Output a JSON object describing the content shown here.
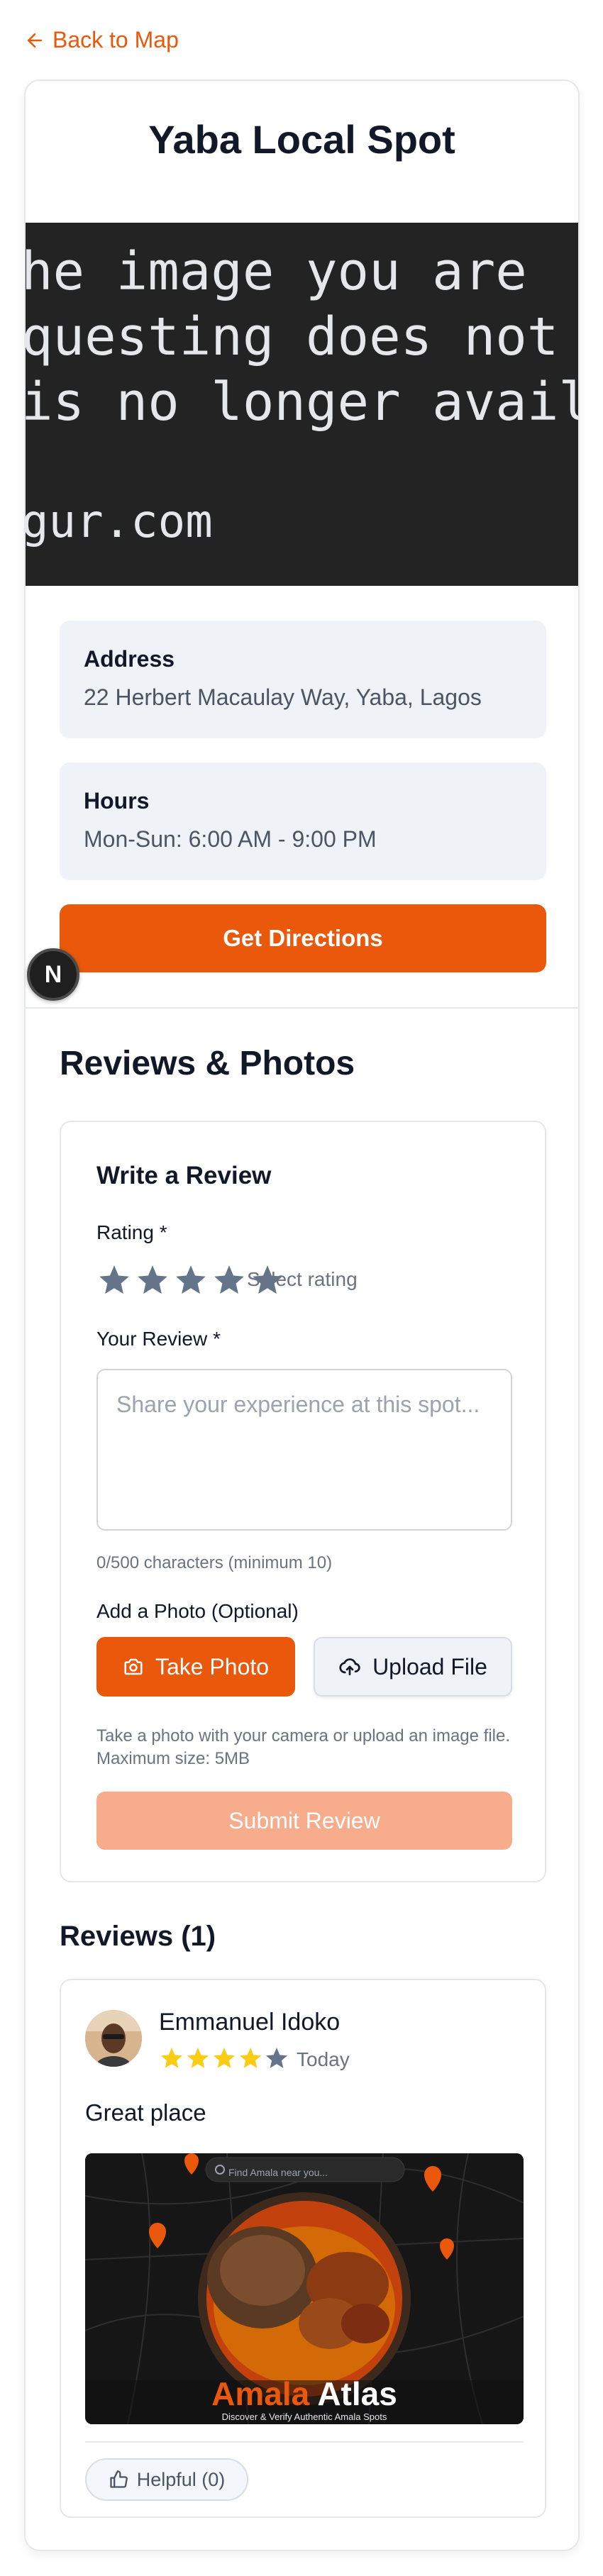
{
  "nav": {
    "back_label": "Back to Map"
  },
  "spot": {
    "title": "Yaba Local Spot",
    "image_text": [
      "he image you are",
      "questing does not exi",
      "is no longer available",
      "gur.com"
    ],
    "address_label": "Address",
    "address_value": "22 Herbert Macaulay Way, Yaba, Lagos",
    "hours_label": "Hours",
    "hours_value": "Mon-Sun: 6:00 AM - 9:00 PM",
    "directions_label": "Get Directions"
  },
  "badge": {
    "letter": "N"
  },
  "reviews_section": {
    "title": "Reviews & Photos",
    "form": {
      "title": "Write a Review",
      "rating_label": "Rating *",
      "rating_hint": "Select rating",
      "review_label": "Your Review *",
      "review_placeholder": "Share your experience at this spot...",
      "char_count": "0/500 characters (minimum 10)",
      "photo_label": "Add a Photo (Optional)",
      "take_photo_label": "Take Photo",
      "upload_label": "Upload File",
      "helper_text": "Take a photo with your camera or upload an image file. Maximum size: 5MB",
      "submit_label": "Submit Review"
    },
    "list_title": "Reviews (1)",
    "reviews": [
      {
        "name": "Emmanuel Idoko",
        "rating": 4,
        "date": "Today",
        "text": "Great place",
        "photo": {
          "search_placeholder": "Find Amala near you...",
          "brand_1": "Amala",
          "brand_2": "Atlas",
          "tagline": "Discover & Verify Authentic Amala Spots"
        },
        "helpful_label": "Helpful (0)"
      }
    ]
  },
  "colors": {
    "accent": "#ea580c",
    "submit_disabled": "#f7ad8c",
    "star_filled": "#facc15",
    "star_empty": "#64748b",
    "info_bg": "#eff3f8"
  }
}
